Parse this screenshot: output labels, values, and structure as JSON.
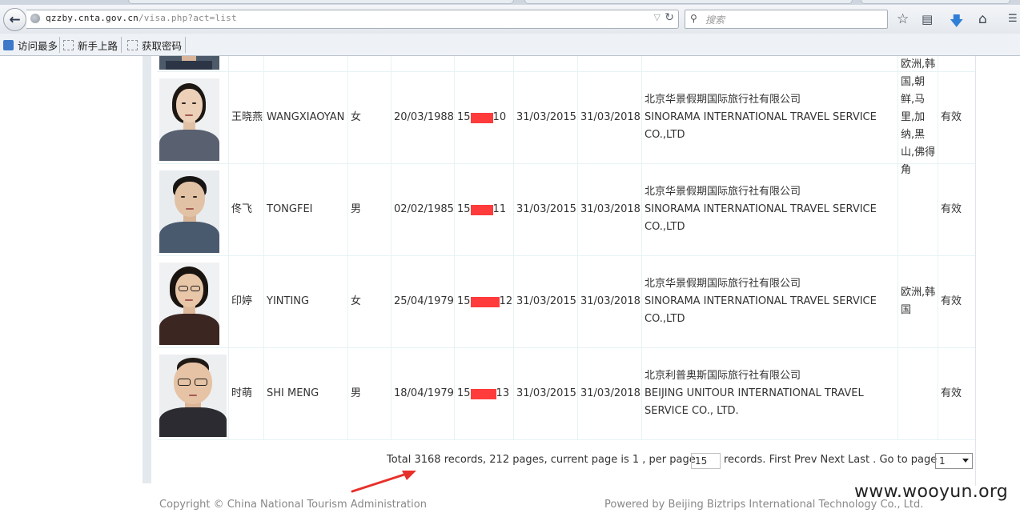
{
  "browser": {
    "url_host": "qzzby.cnta.gov.cn",
    "url_path": "/visa.php?act=list",
    "search_placeholder": "搜索",
    "icons": [
      "back-arrow-icon",
      "globe-icon",
      "dropdown-icon",
      "reload-icon",
      "search-icon",
      "star-icon",
      "clipboard-icon",
      "download-icon",
      "home-icon"
    ],
    "bookmarks": [
      "访问最多",
      "新手上路",
      "获取密码"
    ]
  },
  "table": {
    "rows": [
      {
        "name_cn": "王晓燕",
        "name_en": "WANGXIAOYAN",
        "gender": "女",
        "birth": "20/03/1988",
        "passport_prefix": "15",
        "passport_suffix": "10",
        "issue": "31/03/2015",
        "expiry": "31/03/2018",
        "agency_cn": "北京华景假期国际旅行社有限公司",
        "agency_en": "SINORAMA INTERNATIONAL TRAVEL SERVICE CO.,LTD",
        "region": "欧洲,韩国,朝鲜,马里,加纳,黑山,佛得角",
        "status": "有效"
      },
      {
        "name_cn": "佟飞",
        "name_en": "TONGFEI",
        "gender": "男",
        "birth": "02/02/1985",
        "passport_prefix": "15",
        "passport_suffix": "11",
        "issue": "31/03/2015",
        "expiry": "31/03/2018",
        "agency_cn": "北京华景假期国际旅行社有限公司",
        "agency_en": "SINORAMA INTERNATIONAL TRAVEL SERVICE CO.,LTD",
        "region": "",
        "status": "有效"
      },
      {
        "name_cn": "印婷",
        "name_en": "YINTING",
        "gender": "女",
        "birth": "25/04/1979",
        "passport_prefix": "15",
        "passport_suffix": "12",
        "issue": "31/03/2015",
        "expiry": "31/03/2018",
        "agency_cn": "北京华景假期国际旅行社有限公司",
        "agency_en": "SINORAMA INTERNATIONAL TRAVEL SERVICE CO.,LTD",
        "region": "欧洲,韩国",
        "status": "有效"
      },
      {
        "name_cn": "时萌",
        "name_en": "SHI MENG",
        "gender": "男",
        "birth": "18/04/1979",
        "passport_prefix": "15",
        "passport_suffix": "13",
        "issue": "31/03/2015",
        "expiry": "31/03/2018",
        "agency_cn": "北京利普奥斯国际旅行社有限公司",
        "agency_en": "BEIJING UNITOUR INTERNATIONAL TRAVEL SERVICE CO., LTD.",
        "region": "",
        "status": "有效"
      }
    ]
  },
  "pager": {
    "summary": "Total 3168 records, 212 pages, current page is 1 , per page",
    "per_page": "15",
    "tail": "records. First Prev Next Last . Go to page",
    "goto_page": "1"
  },
  "footer": {
    "copyright": "Copyright © China National Tourism Administration",
    "powered": "Powered by Beijing Biztrips International Technology Co., Ltd."
  },
  "watermark": "www.wooyun.org",
  "colors": {
    "grid": "#e7f3f3",
    "redaction": "#ff3b3b",
    "annotation_arrow": "#e8302a"
  }
}
